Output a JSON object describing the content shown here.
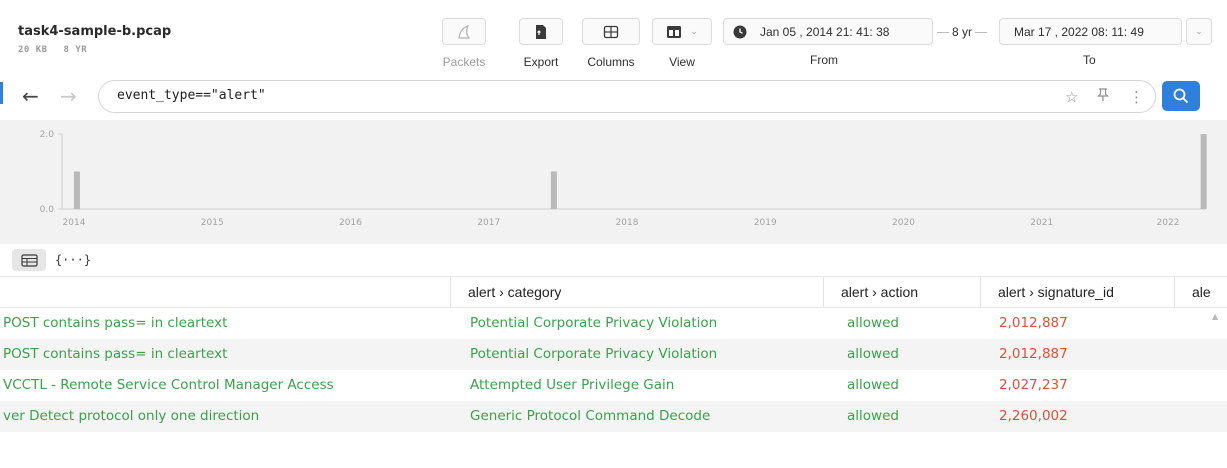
{
  "file": {
    "name": "task4-sample-b.pcap",
    "size": "20 KB",
    "span": "8 YR"
  },
  "toolbar": {
    "packets": "Packets",
    "export": "Export",
    "columns": "Columns",
    "view": "View"
  },
  "range": {
    "from_value": "Jan 05 , 2014 21: 41: 38",
    "duration": "8 yr",
    "to_value": "Mar 17 , 2022 08: 11: 49",
    "from_label": "From",
    "to_label": "To"
  },
  "search": {
    "query": "event_type==\"alert\""
  },
  "histogram": {
    "y_ticks": [
      "2.0",
      "0.0"
    ],
    "x_ticks": [
      "2014",
      "2015",
      "2016",
      "2017",
      "2018",
      "2019",
      "2020",
      "2021",
      "2022"
    ],
    "bars": [
      {
        "year": 2014.05,
        "count": 1
      },
      {
        "year": 2017.5,
        "count": 1
      },
      {
        "year": 2022.2,
        "count": 2
      }
    ]
  },
  "view_toggle": {
    "json_label": "{···}"
  },
  "table": {
    "headers": [
      "alert › category",
      "alert › action",
      "alert › signature_id",
      "ale"
    ],
    "rows": [
      {
        "signature": "POST contains pass= in cleartext",
        "category": "Potential Corporate Privacy Violation",
        "action": "allowed",
        "signature_id": "2,012,887"
      },
      {
        "signature": "POST contains pass= in cleartext",
        "category": "Potential Corporate Privacy Violation",
        "action": "allowed",
        "signature_id": "2,012,887"
      },
      {
        "signature": "VCCTL - Remote Service Control Manager Access",
        "category": "Attempted User Privilege Gain",
        "action": "allowed",
        "signature_id": "2,027,237"
      },
      {
        "signature": "ver Detect protocol only one direction",
        "category": "Generic Protocol Command Decode",
        "action": "allowed",
        "signature_id": "2,260,002"
      }
    ]
  },
  "colors": {
    "accent": "#2f7fdc",
    "green": "#3aa24a",
    "red": "#e0503b",
    "bar": "#b9b9b9"
  }
}
